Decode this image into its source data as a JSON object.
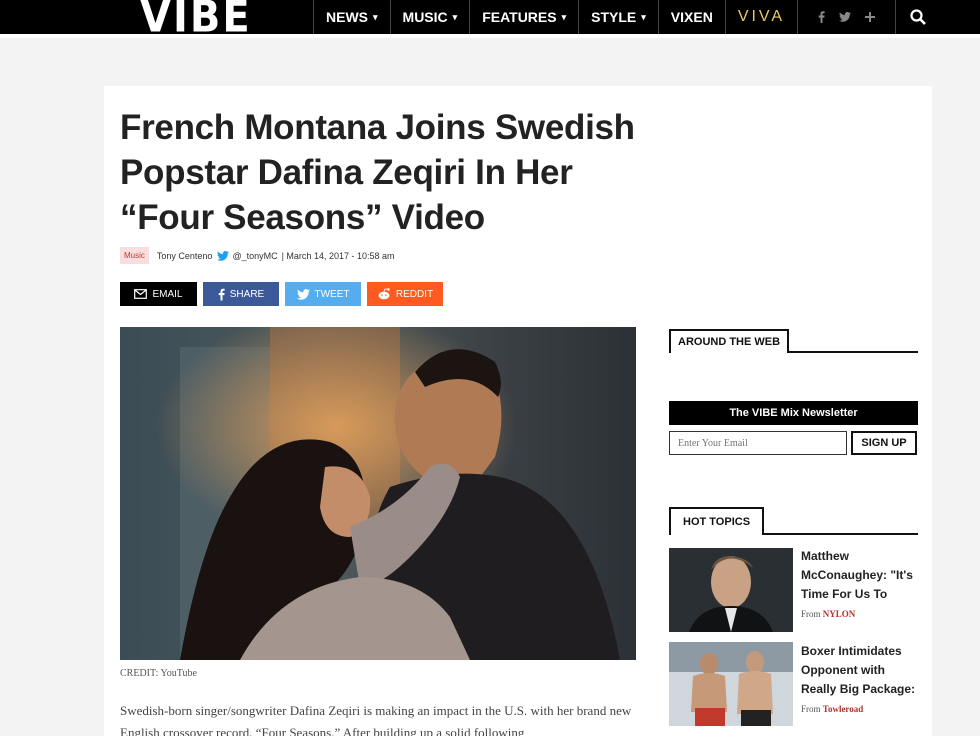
{
  "header": {
    "logo": "VIBE",
    "nav": [
      {
        "label": "NEWS",
        "caret": "▾"
      },
      {
        "label": "MUSIC",
        "caret": "▾"
      },
      {
        "label": "FEATURES",
        "caret": "▾"
      },
      {
        "label": "STYLE",
        "caret": "▾"
      },
      {
        "label": "VIXEN",
        "caret": ""
      },
      {
        "label": "VIVA",
        "caret": ""
      }
    ],
    "social_icons": [
      "facebook-icon",
      "twitter-icon",
      "plus-icon"
    ],
    "search_icon": "search-icon"
  },
  "article": {
    "title": "French Montana Joins Swedish Popstar Dafina Zeqiri In Her “Four Seasons” Video",
    "category": "Music",
    "author": "Tony Centeno",
    "handle": "@_tonyMC",
    "date": "| March 14, 2017 - 10:58 am",
    "share": {
      "email": "EMAIL",
      "facebook": "SHARE",
      "twitter": "TWEET",
      "reddit": "REDDIT"
    },
    "credit": "CREDIT: YouTube",
    "body": "Swedish-born singer/songwriter Dafina Zeqiri is making an impact in the U.S. with her brand new English crossover record, “Four Seasons.” After building up a solid following"
  },
  "sidebar": {
    "around_web": "AROUND THE WEB",
    "newsletter": {
      "title": "The VIBE Mix Newsletter",
      "placeholder": "Enter Your Email",
      "button": "SIGN UP"
    },
    "hot_topics": {
      "heading": "HOT TOPICS",
      "items": [
        {
          "title": "Matthew McConaughey: \"It's Time For Us To",
          "from": "From",
          "source": "NYLON"
        },
        {
          "title": "Boxer Intimidates Opponent with Really Big Package:",
          "from": "From",
          "source": "Towleroad"
        }
      ]
    }
  },
  "colors": {
    "email": "#000000",
    "facebook": "#3b5998",
    "twitter": "#55acee",
    "reddit": "#ff5a1f",
    "category_badge_bg": "#f8dede",
    "category_badge_text": "#c0392b"
  }
}
